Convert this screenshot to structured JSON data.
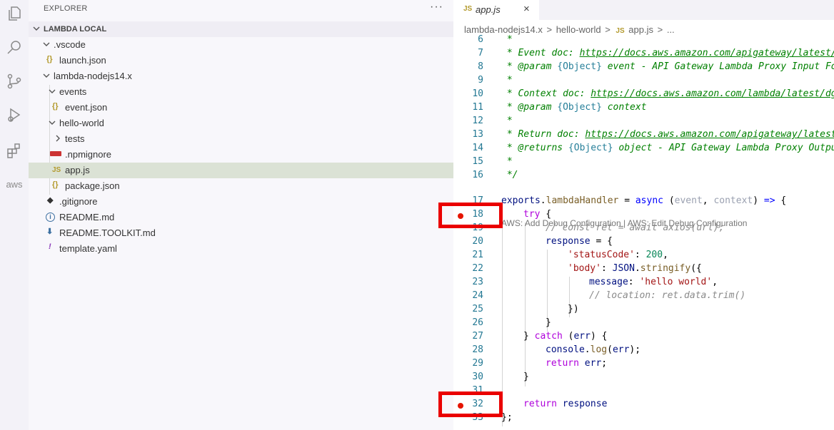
{
  "explorer": {
    "title": "EXPLORER",
    "more": "···",
    "section": "LAMBDA LOCAL",
    "tree": [
      {
        "label": ".vscode",
        "kind": "folder",
        "depth": 1,
        "expanded": true
      },
      {
        "label": "launch.json",
        "kind": "json",
        "depth": 2
      },
      {
        "label": "lambda-nodejs14.x",
        "kind": "folder",
        "depth": 1,
        "expanded": true
      },
      {
        "label": "events",
        "kind": "folder",
        "depth": 2,
        "expanded": true
      },
      {
        "label": "event.json",
        "kind": "json",
        "depth": 3
      },
      {
        "label": "hello-world",
        "kind": "folder",
        "depth": 2,
        "expanded": true
      },
      {
        "label": "tests",
        "kind": "folder",
        "depth": 3,
        "expanded": false
      },
      {
        "label": ".npmignore",
        "kind": "npm",
        "depth": 3
      },
      {
        "label": "app.js",
        "kind": "js",
        "depth": 3,
        "selected": true
      },
      {
        "label": "package.json",
        "kind": "json",
        "depth": 3
      },
      {
        "label": ".gitignore",
        "kind": "git",
        "depth": 1
      },
      {
        "label": "README.md",
        "kind": "info",
        "depth": 1
      },
      {
        "label": "README.TOOLKIT.md",
        "kind": "download",
        "depth": 1
      },
      {
        "label": "template.yaml",
        "kind": "yaml",
        "depth": 1
      }
    ]
  },
  "tab": {
    "icon": "JS",
    "label": "app.js",
    "close": "×"
  },
  "breadcrumb": {
    "parts": [
      "lambda-nodejs14.x",
      ">",
      "hello-world",
      ">"
    ],
    "file_icon": "JS",
    "file": "app.js",
    "sep": ">",
    "more": "..."
  },
  "activity_icons": [
    "files-icon",
    "search-icon",
    "source-control-icon",
    "run-debug-icon",
    "extensions-icon",
    "aws-icon"
  ],
  "aws_label": "aws",
  "codelens": "AWS: Add Debug Configuration | AWS: Edit Debug Configuration",
  "line_numbers": [
    "6",
    "7",
    "8",
    "9",
    "10",
    "11",
    "12",
    "13",
    "14",
    "15",
    "16",
    "17",
    "18",
    "19",
    "20",
    "21",
    "22",
    "23",
    "24",
    "25",
    "26",
    "27",
    "28",
    "29",
    "30",
    "31",
    "32",
    "33"
  ],
  "code": {
    "l6_star": " *",
    "l7_pre": " * Event doc: ",
    "l7_link": "https://docs.aws.amazon.com/apigateway/latest/developerguide/set-up-lambda-proxy-integrations.html",
    "l8_tag": " * @param ",
    "l8_type": "{Object}",
    "l8_rest": " event - API Gateway Lambda Proxy Input Format",
    "l9_star": " *",
    "l10_pre": " * Context doc: ",
    "l10_link": "https://docs.aws.amazon.com/lambda/latest/dg/nodejs-prog-model-context.html",
    "l11_tag": " * @param ",
    "l11_type": "{Object}",
    "l11_rest": " context",
    "l12_star": " *",
    "l13_pre": " * Return doc: ",
    "l13_link": "https://docs.aws.amazon.com/apigateway/latest/developerguide/set-up-lambda-proxy-integrations.html",
    "l14_tag": " * @returns ",
    "l14_type": "{Object}",
    "l14_rest": " object - API Gateway Lambda Proxy Output Format",
    "l15_star": " *",
    "l16_end": " */",
    "l17_exports": "exports",
    "l17_dot": ".",
    "l17_handler": "lambdaHandler",
    "l17_eq": " = ",
    "l17_async": "async",
    "l17_open": " (",
    "l17_event": "event",
    "l17_comma": ", ",
    "l17_context": "context",
    "l17_close": ") ",
    "l17_arrow": "=>",
    "l17_brace": " {",
    "l18_try": "try",
    "l18_brace": " {",
    "l19_comment": "// const ret = await axios(url);",
    "l20_resp": "response",
    "l20_rest": " = {",
    "l21_key": "'statusCode'",
    "l21_colon": ": ",
    "l21_num": "200",
    "l21_comma": ",",
    "l22_key": "'body'",
    "l22_colon": ": ",
    "l22_json": "JSON",
    "l22_dot": ".",
    "l22_fn": "stringify",
    "l22_open": "({",
    "l23_key": "message",
    "l23_colon": ": ",
    "l23_str": "'hello world'",
    "l23_comma": ",",
    "l24_comment": "// location: ret.data.trim()",
    "l25_close": "})",
    "l26_close": "}",
    "l27_close": "} ",
    "l27_catch": "catch",
    "l27_open": " (",
    "l27_err": "err",
    "l27_rest": ") {",
    "l28_console": "console",
    "l28_dot": ".",
    "l28_fn": "log",
    "l28_open": "(",
    "l28_err": "err",
    "l28_close": ");",
    "l29_return": "return",
    "l29_err": " err",
    "l29_semi": ";",
    "l30_close": "}",
    "l32_return": "return",
    "l32_resp": " response",
    "l33_close": "};"
  },
  "breakpoint_lines": [
    "18",
    "32"
  ],
  "colors": {
    "breakpoint": "#e51400",
    "highlight_box": "#ea0000",
    "selection": "#dbe2d5"
  }
}
